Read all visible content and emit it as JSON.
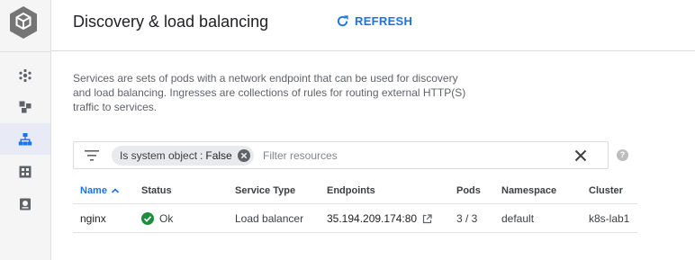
{
  "header": {
    "title": "Discovery & load balancing",
    "refresh_label": "REFRESH"
  },
  "description": "Services are sets of pods with a network endpoint that can be used for discovery and load balancing. Ingresses are collections of rules for routing external HTTP(S) traffic to services.",
  "filter": {
    "chip_key": "Is system object",
    "chip_sep": ":",
    "chip_value": "False",
    "placeholder": "Filter resources"
  },
  "table": {
    "columns": [
      "Name",
      "Status",
      "Service Type",
      "Endpoints",
      "Pods",
      "Namespace",
      "Cluster"
    ],
    "rows": [
      {
        "name": "nginx",
        "status": "Ok",
        "service_type": "Load balancer",
        "endpoints": "35.194.209.174:80",
        "pods": "3 / 3",
        "namespace": "default",
        "cluster": "k8s-lab1"
      }
    ]
  },
  "colors": {
    "accent": "#1a73e8",
    "status_ok": "#1e8e3e",
    "rail_active": "#e8eaf6"
  },
  "icons": {
    "logo": "kubernetes-engine-icon",
    "nav": [
      "clusters-icon",
      "workloads-icon",
      "services-icon",
      "applications-icon",
      "configuration-icon"
    ],
    "refresh": "refresh-icon",
    "filter": "filter-list-icon",
    "help": "help-icon"
  }
}
